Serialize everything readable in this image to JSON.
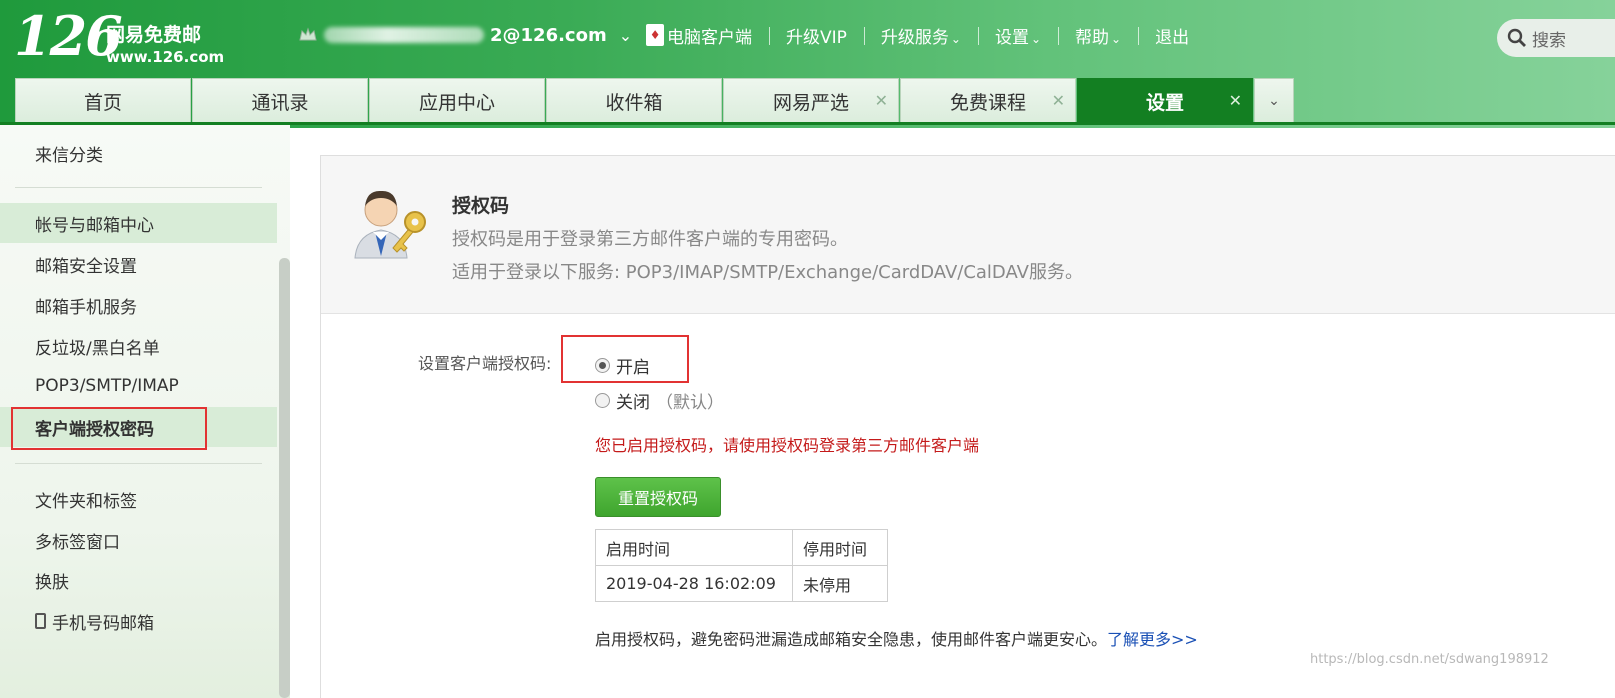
{
  "logo": {
    "number": "126",
    "name": "网易免费邮",
    "url": "www.126.com"
  },
  "account": {
    "email_domain": "2@126.com"
  },
  "topnav": {
    "items": [
      {
        "label": "电脑客户端",
        "dropdown": false
      },
      {
        "label": "升级VIP",
        "dropdown": false
      },
      {
        "label": "升级服务",
        "dropdown": true
      },
      {
        "label": "设置",
        "dropdown": true
      },
      {
        "label": "帮助",
        "dropdown": true
      },
      {
        "label": "退出",
        "dropdown": false
      }
    ],
    "search_label": "搜索"
  },
  "tabs": [
    {
      "label": "首页",
      "closable": false,
      "active": false
    },
    {
      "label": "通讯录",
      "closable": false,
      "active": false
    },
    {
      "label": "应用中心",
      "closable": false,
      "active": false
    },
    {
      "label": "收件箱",
      "closable": false,
      "active": false
    },
    {
      "label": "网易严选",
      "closable": true,
      "active": false
    },
    {
      "label": "免费课程",
      "closable": true,
      "active": false
    },
    {
      "label": "设置",
      "closable": true,
      "active": true
    }
  ],
  "sidebar": {
    "items": [
      {
        "label": "来信分类"
      },
      {
        "label": "帐号与邮箱中心"
      },
      {
        "label": "邮箱安全设置"
      },
      {
        "label": "邮箱手机服务"
      },
      {
        "label": "反垃圾/黑白名单"
      },
      {
        "label": "POP3/SMTP/IMAP"
      },
      {
        "label": "客户端授权密码"
      },
      {
        "label": "文件夹和标签"
      },
      {
        "label": "多标签窗口"
      },
      {
        "label": "换肤"
      },
      {
        "label": "手机号码邮箱"
      }
    ]
  },
  "main": {
    "title": "授权码",
    "desc1": "授权码是用于登录第三方邮件客户端的专用密码。",
    "desc2": "适用于登录以下服务: POP3/IMAP/SMTP/Exchange/CardDAV/CalDAV服务。",
    "setting_label": "设置客户端授权码:",
    "option_on": "开启",
    "option_off": "关闭",
    "option_off_hint": "（默认）",
    "notice": "您已启用授权码，请使用授权码登录第三方邮件客户端",
    "reset_button": "重置授权码",
    "table": {
      "headers": [
        "启用时间",
        "停用时间"
      ],
      "rows": [
        [
          "2019-04-28 16:02:09",
          "未停用"
        ]
      ]
    },
    "footer_text": "启用授权码，避免密码泄漏造成邮箱安全隐患，使用邮件客户端更安心。",
    "footer_link": "了解更多>>"
  },
  "watermark": "https://blog.csdn.net/sdwang198912",
  "colors": {
    "brand_green": "#137f22",
    "notice_red": "#c41a1a",
    "link_blue": "#1a50b5",
    "highlight_red": "#e23232"
  }
}
